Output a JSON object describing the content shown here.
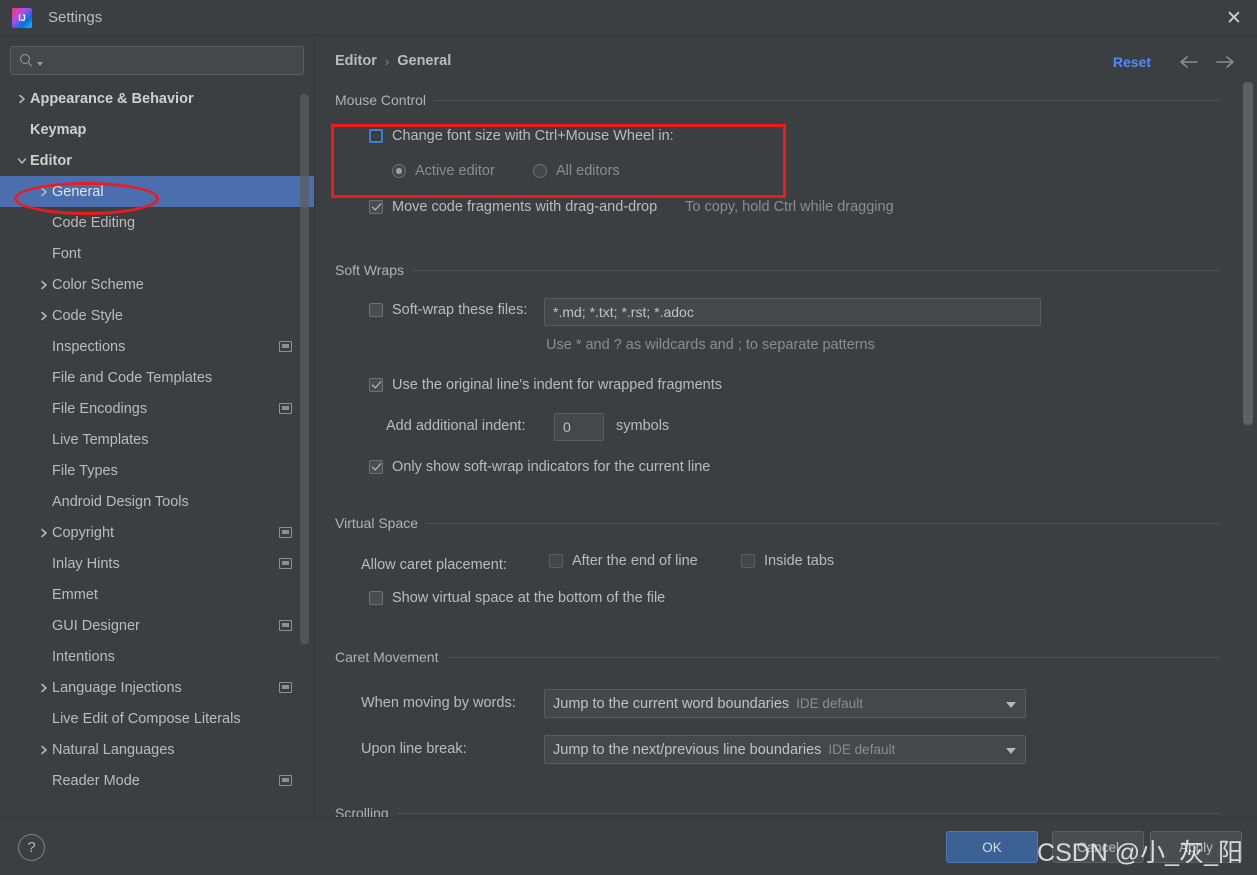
{
  "window": {
    "title": "Settings",
    "app_icon": "intellij-idea-icon",
    "close_label": "✕"
  },
  "sidebar": {
    "search": {
      "placeholder": "",
      "value": "",
      "icon": "search-icon"
    },
    "items": [
      {
        "label": "Appearance & Behavior",
        "indent": 0,
        "chevron": "collapsed",
        "bold": true,
        "selected": false,
        "project_icon": false
      },
      {
        "label": "Keymap",
        "indent": 0,
        "chevron": "none",
        "bold": true,
        "selected": false,
        "project_icon": false
      },
      {
        "label": "Editor",
        "indent": 0,
        "chevron": "expanded",
        "bold": true,
        "selected": false,
        "project_icon": false
      },
      {
        "label": "General",
        "indent": 1,
        "chevron": "collapsed",
        "bold": false,
        "selected": true,
        "project_icon": false
      },
      {
        "label": "Code Editing",
        "indent": 1,
        "chevron": "none",
        "bold": false,
        "selected": false,
        "project_icon": false
      },
      {
        "label": "Font",
        "indent": 1,
        "chevron": "none",
        "bold": false,
        "selected": false,
        "project_icon": false
      },
      {
        "label": "Color Scheme",
        "indent": 1,
        "chevron": "collapsed",
        "bold": false,
        "selected": false,
        "project_icon": false
      },
      {
        "label": "Code Style",
        "indent": 1,
        "chevron": "collapsed",
        "bold": false,
        "selected": false,
        "project_icon": false
      },
      {
        "label": "Inspections",
        "indent": 1,
        "chevron": "none",
        "bold": false,
        "selected": false,
        "project_icon": true
      },
      {
        "label": "File and Code Templates",
        "indent": 1,
        "chevron": "none",
        "bold": false,
        "selected": false,
        "project_icon": false
      },
      {
        "label": "File Encodings",
        "indent": 1,
        "chevron": "none",
        "bold": false,
        "selected": false,
        "project_icon": true
      },
      {
        "label": "Live Templates",
        "indent": 1,
        "chevron": "none",
        "bold": false,
        "selected": false,
        "project_icon": false
      },
      {
        "label": "File Types",
        "indent": 1,
        "chevron": "none",
        "bold": false,
        "selected": false,
        "project_icon": false
      },
      {
        "label": "Android Design Tools",
        "indent": 1,
        "chevron": "none",
        "bold": false,
        "selected": false,
        "project_icon": false
      },
      {
        "label": "Copyright",
        "indent": 1,
        "chevron": "collapsed",
        "bold": false,
        "selected": false,
        "project_icon": true
      },
      {
        "label": "Inlay Hints",
        "indent": 1,
        "chevron": "none",
        "bold": false,
        "selected": false,
        "project_icon": true
      },
      {
        "label": "Emmet",
        "indent": 1,
        "chevron": "none",
        "bold": false,
        "selected": false,
        "project_icon": false
      },
      {
        "label": "GUI Designer",
        "indent": 1,
        "chevron": "none",
        "bold": false,
        "selected": false,
        "project_icon": true
      },
      {
        "label": "Intentions",
        "indent": 1,
        "chevron": "none",
        "bold": false,
        "selected": false,
        "project_icon": false
      },
      {
        "label": "Language Injections",
        "indent": 1,
        "chevron": "collapsed",
        "bold": false,
        "selected": false,
        "project_icon": true
      },
      {
        "label": "Live Edit of Compose Literals",
        "indent": 1,
        "chevron": "none",
        "bold": false,
        "selected": false,
        "project_icon": false
      },
      {
        "label": "Natural Languages",
        "indent": 1,
        "chevron": "collapsed",
        "bold": false,
        "selected": false,
        "project_icon": false
      },
      {
        "label": "Reader Mode",
        "indent": 1,
        "chevron": "none",
        "bold": false,
        "selected": false,
        "project_icon": true
      }
    ]
  },
  "header": {
    "breadcrumb_root": "Editor",
    "breadcrumb_sep": "›",
    "breadcrumb_leaf": "General",
    "reset_label": "Reset",
    "back_icon": "arrow-left-icon",
    "forward_icon": "arrow-right-icon"
  },
  "sections": {
    "mouse_control": {
      "title": "Mouse Control",
      "change_font_size_label": "Change font size with Ctrl+Mouse Wheel in:",
      "change_font_size_checked": false,
      "radio_active_editor": "Active editor",
      "radio_all_editors": "All editors",
      "radio_selected": "Active editor",
      "drag_drop_label": "Move code fragments with drag-and-drop",
      "drag_drop_checked": true,
      "drag_drop_hint": "To copy, hold Ctrl while dragging"
    },
    "soft_wraps": {
      "title": "Soft Wraps",
      "soft_wrap_files_label": "Soft-wrap these files:",
      "soft_wrap_files_checked": false,
      "soft_wrap_files_value": "*.md; *.txt; *.rst; *.adoc",
      "wildcard_hint": "Use * and ? as wildcards and ; to separate patterns",
      "original_indent_label": "Use the original line's indent for wrapped fragments",
      "original_indent_checked": true,
      "additional_indent_label": "Add additional indent:",
      "additional_indent_value": "0",
      "additional_indent_suffix": "symbols",
      "only_show_indicators_label": "Only show soft-wrap indicators for the current line",
      "only_show_indicators_checked": true
    },
    "virtual_space": {
      "title": "Virtual Space",
      "allow_caret_label": "Allow caret placement:",
      "after_end_of_line_label": "After the end of line",
      "after_end_of_line_checked": false,
      "inside_tabs_label": "Inside tabs",
      "inside_tabs_checked": false,
      "show_virtual_space_label": "Show virtual space at the bottom of the file",
      "show_virtual_space_checked": false
    },
    "caret_movement": {
      "title": "Caret Movement",
      "when_moving_label": "When moving by words:",
      "when_moving_value": "Jump to the current word boundaries",
      "when_moving_suffix": "IDE default",
      "upon_line_break_label": "Upon line break:",
      "upon_line_break_value": "Jump to the next/previous line boundaries",
      "upon_line_break_suffix": "IDE default"
    },
    "scrolling": {
      "title": "Scrolling"
    }
  },
  "footer": {
    "help_label": "?",
    "ok_label": "OK",
    "cancel_label": "Cancel",
    "apply_label": "Apply"
  },
  "annotations": {
    "watermark_text": "CSDN @小_灰_阳",
    "highlight_color": "#ef1b1b"
  }
}
